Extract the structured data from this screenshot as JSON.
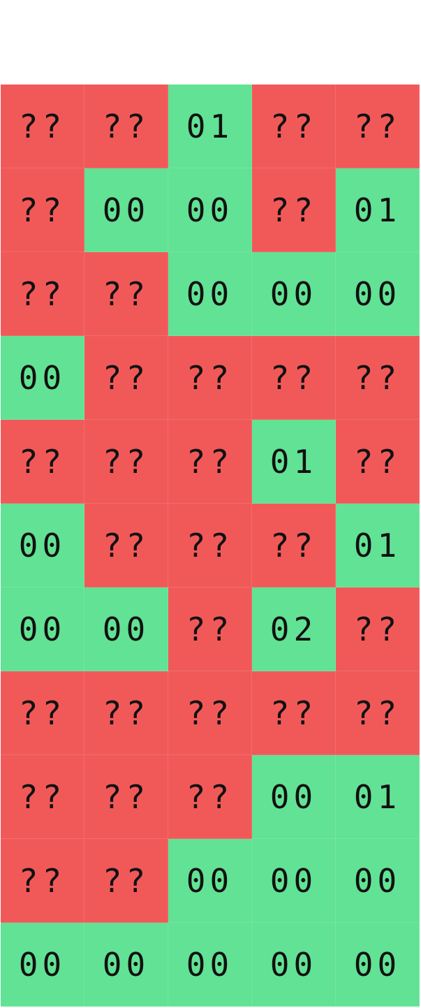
{
  "colors": {
    "unknown": "#f15959",
    "revealed": "#62e294",
    "text": "#111111"
  },
  "board": {
    "rows": [
      [
        "??",
        "??",
        "01",
        "??",
        "??"
      ],
      [
        "??",
        "00",
        "00",
        "??",
        "01"
      ],
      [
        "??",
        "??",
        "00",
        "00",
        "00"
      ],
      [
        "00",
        "??",
        "??",
        "??",
        "??"
      ],
      [
        "??",
        "??",
        "??",
        "01",
        "??"
      ],
      [
        "00",
        "??",
        "??",
        "??",
        "01"
      ],
      [
        "00",
        "00",
        "??",
        "02",
        "??"
      ],
      [
        "??",
        "??",
        "??",
        "??",
        "??"
      ],
      [
        "??",
        "??",
        "??",
        "00",
        "01"
      ],
      [
        "??",
        "??",
        "00",
        "00",
        "00"
      ],
      [
        "00",
        "00",
        "00",
        "00",
        "00"
      ]
    ]
  }
}
